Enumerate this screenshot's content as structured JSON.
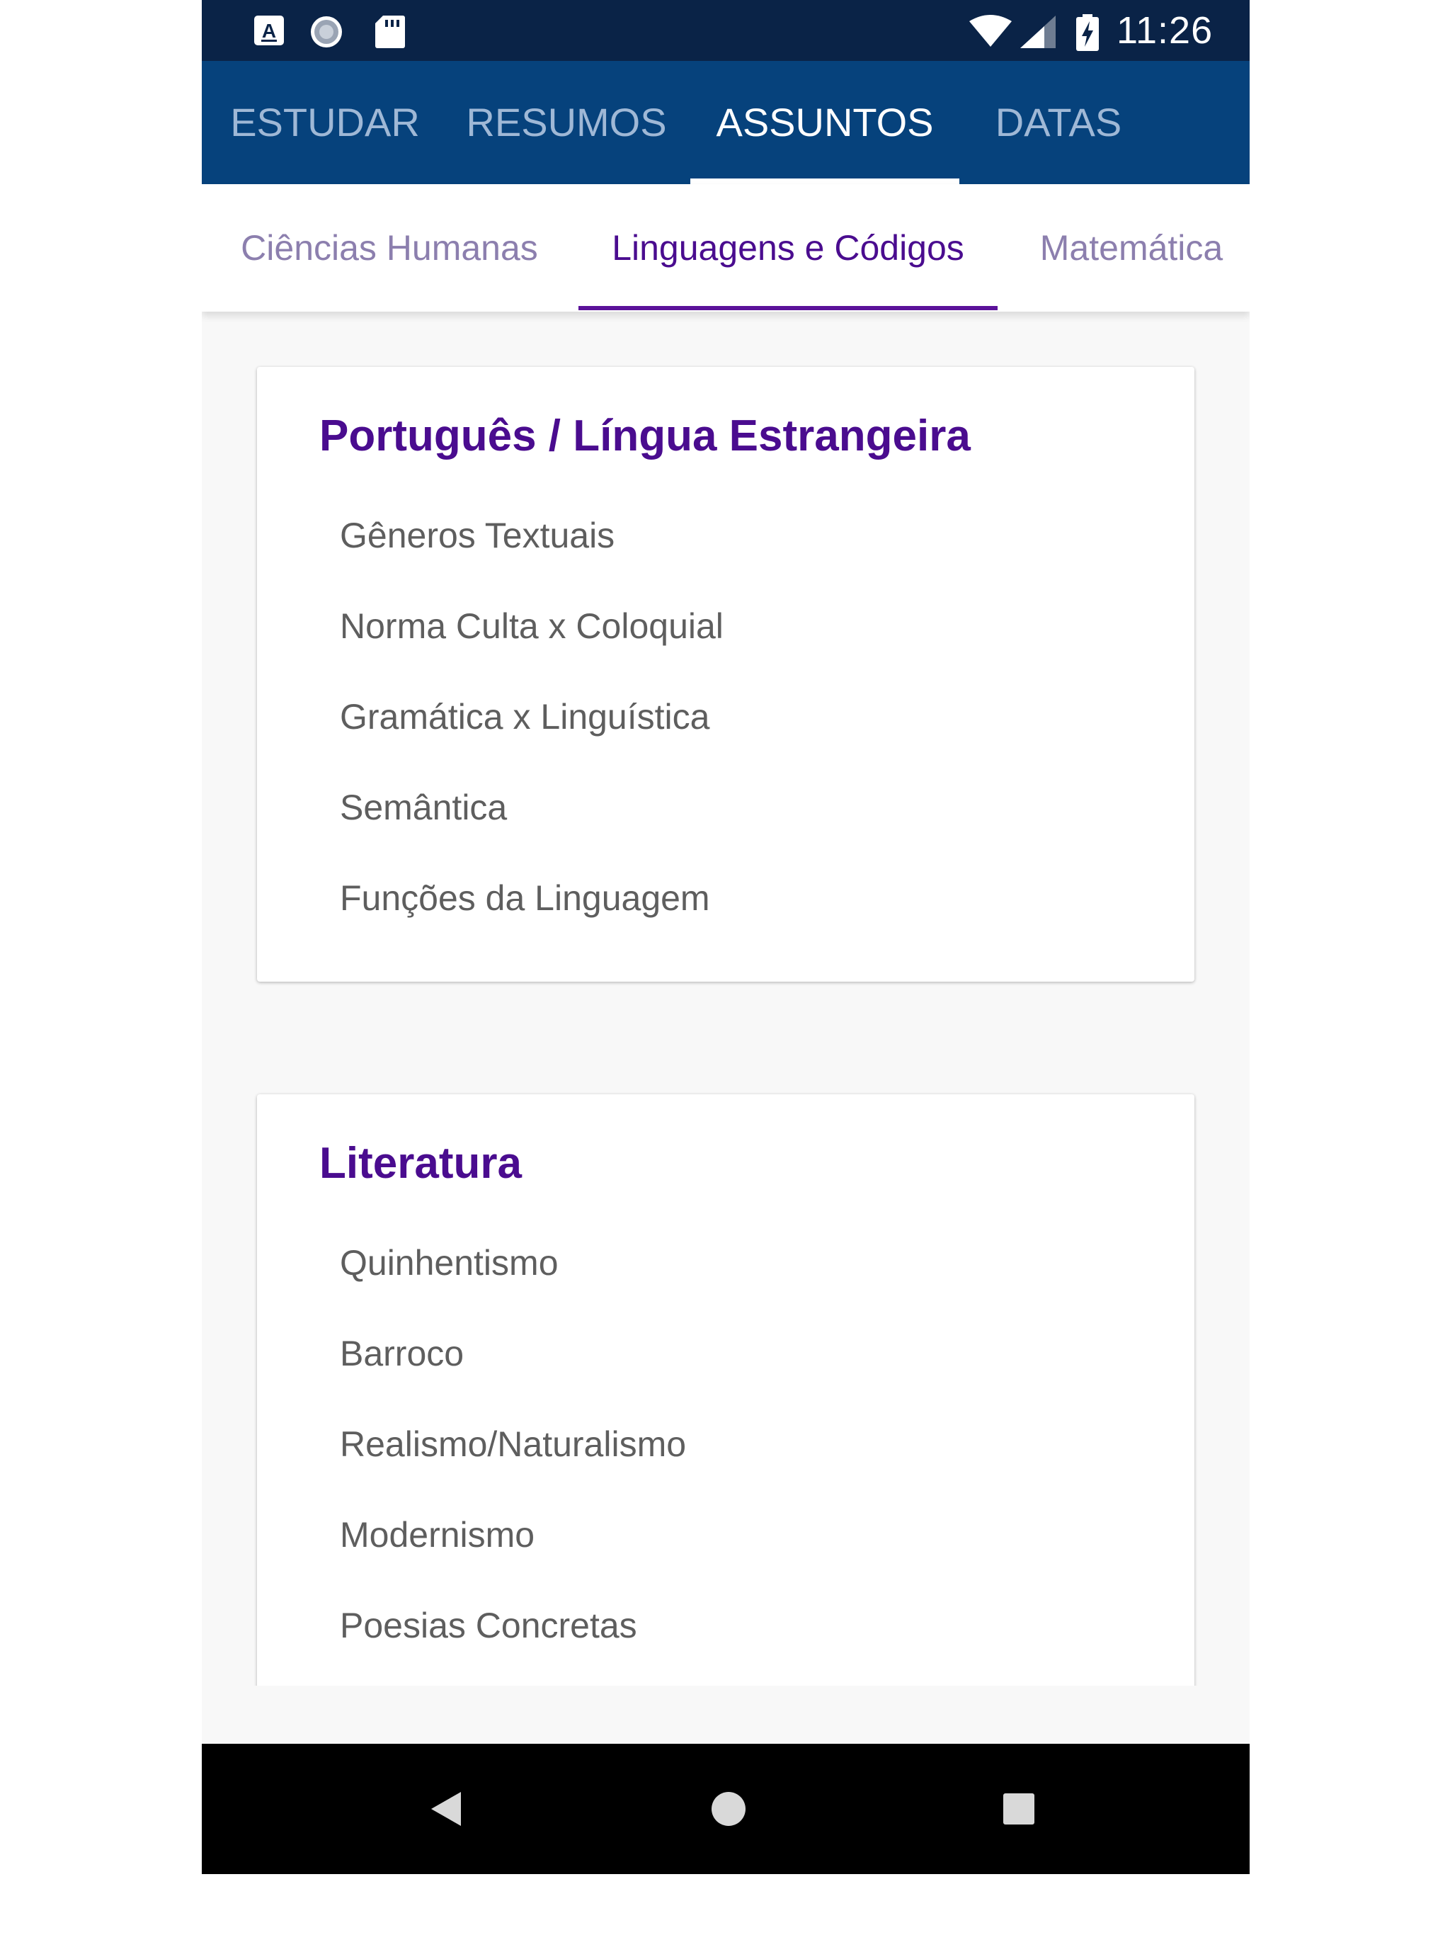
{
  "status_bar": {
    "time": "11:26",
    "icons": [
      "a-text-icon",
      "moon-icon",
      "sd-card-icon",
      "wifi-icon",
      "signal-icon",
      "battery-charging-icon"
    ]
  },
  "app_tabs": [
    {
      "label": "ESTUDAR",
      "active": false
    },
    {
      "label": "RESUMOS",
      "active": false
    },
    {
      "label": "ASSUNTOS",
      "active": true
    },
    {
      "label": "DATAS",
      "active": false
    }
  ],
  "sub_tabs": [
    {
      "label": "Ciências Humanas",
      "active": false
    },
    {
      "label": "Linguagens e Códigos",
      "active": true
    },
    {
      "label": "Matemática",
      "active": false
    }
  ],
  "cards": [
    {
      "title": "Português / Língua Estrangeira",
      "items": [
        "Gêneros Textuais",
        "Norma Culta x Coloquial",
        "Gramática x Linguística",
        "Semântica",
        "Funções da Linguagem"
      ]
    },
    {
      "title": "Literatura",
      "items": [
        "Quinhentismo",
        "Barroco",
        "Realismo/Naturalismo",
        "Modernismo",
        "Poesias Concretas"
      ]
    }
  ],
  "nav_bar": {
    "buttons": [
      "back-icon",
      "home-icon",
      "recents-icon"
    ]
  },
  "colors": {
    "status_bar_bg": "#0a2347",
    "app_bar_bg": "#06427c",
    "accent_purple": "#4a0c8f",
    "inactive_tab": "#9fb8d6",
    "inactive_subtab": "#8c7fae",
    "item_text": "#5e5e5e"
  }
}
